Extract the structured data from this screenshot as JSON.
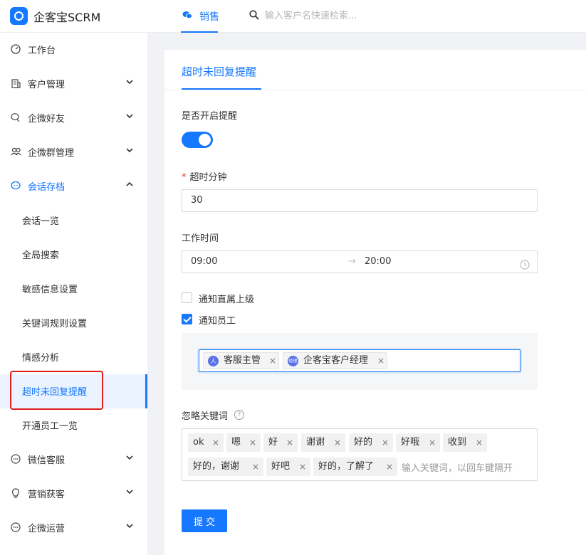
{
  "header": {
    "brand": "企客宝SCRM",
    "active_tab": "销售",
    "search_placeholder": "输入客户名快速检索..."
  },
  "sidebar": {
    "items": [
      {
        "label": "工作台",
        "icon": "dashboard-icon"
      },
      {
        "label": "客户管理",
        "icon": "building-icon"
      },
      {
        "label": "企微好友",
        "icon": "friend-icon"
      },
      {
        "label": "企微群管理",
        "icon": "group-icon"
      },
      {
        "label": "会话存档",
        "icon": "chat-icon"
      },
      {
        "label": "微信客服",
        "icon": "chat-dots-icon"
      },
      {
        "label": "营销获客",
        "icon": "bulb-icon"
      },
      {
        "label": "企微运营",
        "icon": "chat-dots-icon"
      }
    ],
    "sub_items": [
      {
        "label": "会话一览"
      },
      {
        "label": "全局搜索"
      },
      {
        "label": "敏感信息设置"
      },
      {
        "label": "关键词规则设置"
      },
      {
        "label": "情感分析"
      },
      {
        "label": "超时未回复提醒"
      },
      {
        "label": "开通员工一览"
      }
    ]
  },
  "page": {
    "tab": "超时未回复提醒",
    "enable_label": "是否开启提醒",
    "enabled": true,
    "timeout_label": "超时分钟",
    "required_mark": "*",
    "timeout_value": "30",
    "work_time_label": "工作时间",
    "work_start": "09:00",
    "work_arrow": "→",
    "work_end": "20:00",
    "notify_superior": {
      "label": "通知直属上级",
      "checked": false
    },
    "notify_employee": {
      "label": "通知员工",
      "checked": true
    },
    "employees": [
      {
        "name": "客服主管",
        "avatar": "人"
      },
      {
        "name": "企客宝客户经理",
        "avatar": "经理"
      }
    ],
    "tag_close": "×",
    "ignore_label": "忽略关键词",
    "help_mark": "?",
    "keywords": [
      "ok",
      "嗯",
      "好",
      "谢谢",
      "好的",
      "好哦",
      "收到",
      "好的，谢谢",
      "好吧",
      "好的，了解了"
    ],
    "keyword_placeholder": "输入关键词，以回车键隔开",
    "submit_label": "提交"
  },
  "colors": {
    "primary": "#1677ff",
    "highlight_box": "#e21d1d"
  }
}
